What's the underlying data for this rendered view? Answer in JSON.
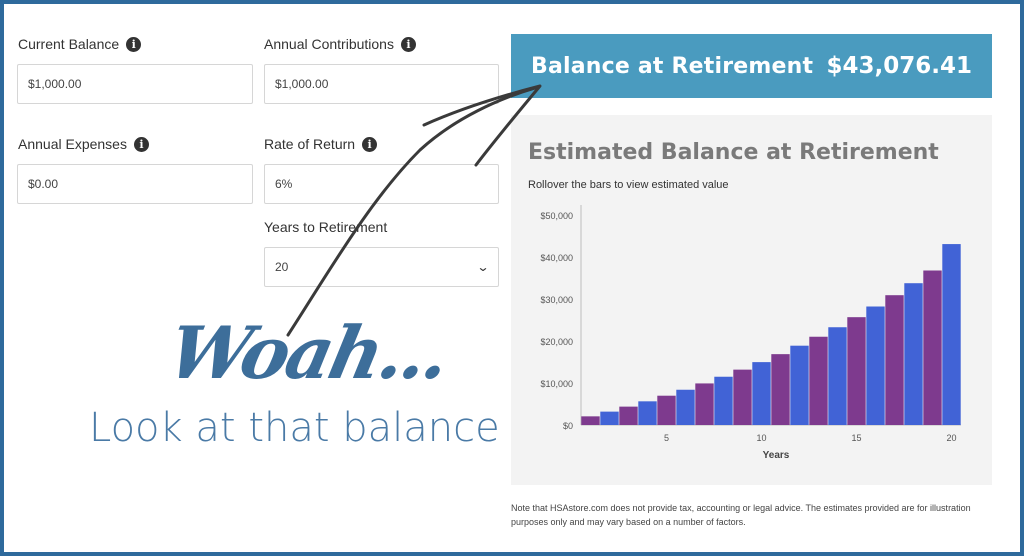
{
  "form": {
    "current_balance": {
      "label": "Current Balance",
      "value": "$1,000.00"
    },
    "annual_contributions": {
      "label": "Annual Contributions",
      "value": "$1,000.00"
    },
    "annual_expenses": {
      "label": "Annual Expenses",
      "value": "$0.00"
    },
    "rate_of_return": {
      "label": "Rate of Return",
      "value": "6%"
    },
    "years_to_retirement": {
      "label": "Years to Retirement",
      "selected": "20"
    },
    "info_icon_glyph": "i"
  },
  "result": {
    "title": "Balance at Retirement",
    "value": "$43,076.41"
  },
  "chart_panel": {
    "title": "Estimated Balance at Retirement",
    "subtitle": "Rollover the bars to view estimated value"
  },
  "chart_data": {
    "type": "bar",
    "title": "Estimated Balance at Retirement",
    "xlabel": "Years",
    "ylabel": "",
    "ylim": [
      0,
      50000
    ],
    "y_ticks": [
      "$0",
      "$10,000",
      "$20,000",
      "$30,000",
      "$40,000",
      "$50,000"
    ],
    "x_ticks": [
      "5",
      "10",
      "15",
      "20"
    ],
    "x": [
      1,
      2,
      3,
      4,
      5,
      6,
      7,
      8,
      9,
      10,
      11,
      12,
      13,
      14,
      15,
      16,
      17,
      18,
      19,
      20
    ],
    "values": [
      2060,
      3184,
      4375,
      5637,
      6975,
      8394,
      9898,
      11491,
      13181,
      14972,
      16870,
      18882,
      21015,
      23276,
      25673,
      28213,
      30906,
      33760,
      36786,
      43076
    ],
    "bar_colors": [
      "#7e3a8e",
      "#4163d6"
    ],
    "grid": false
  },
  "disclaimer": "Note that HSAstore.com does not provide tax, accounting or legal advice. The estimates provided are for illustration purposes only and may vary based on a number of factors.",
  "overlay": {
    "headline": "Woah...",
    "tagline": "Look at that balance"
  },
  "colors": {
    "frame": "#2e6a9c",
    "banner": "#4a9bbf",
    "panel": "#f3f3f3",
    "script_text": "#3d6e9a"
  },
  "icons": [
    "info-icon",
    "chevron-down-icon",
    "hand-drawn-arrow-icon"
  ]
}
